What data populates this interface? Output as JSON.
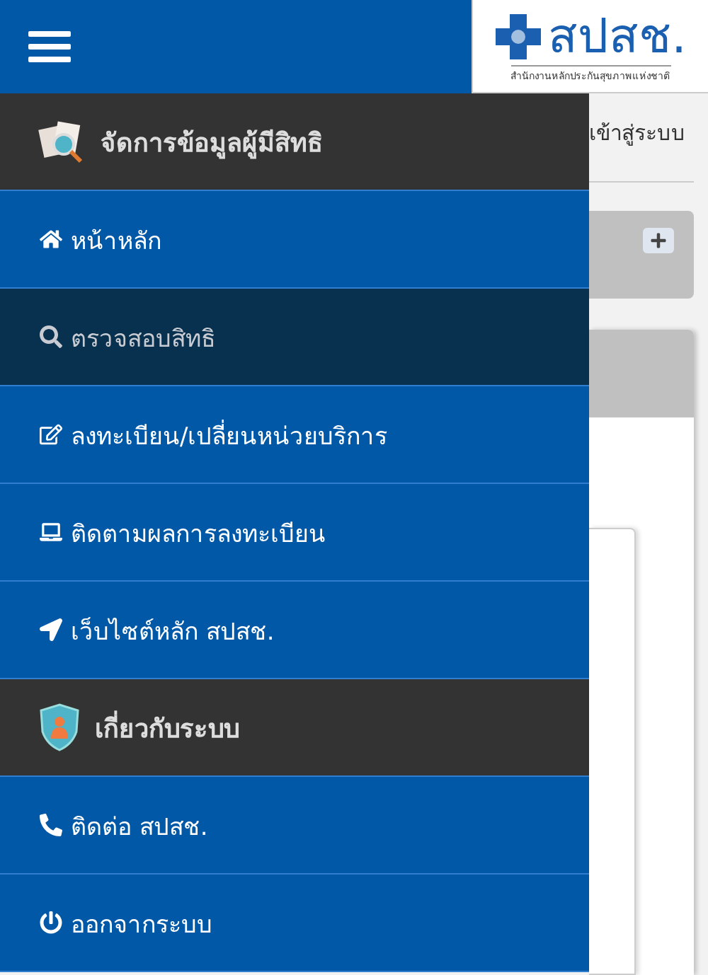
{
  "header": {
    "logo": {
      "title": "สปสช.",
      "subtitle": "สำนักงานหลักประกันสุขภาพแห่งชาติ"
    }
  },
  "background": {
    "login_text": "เข้าสู่ระบบ"
  },
  "menu": [
    {
      "kind": "section",
      "label": "จัดการข้อมูลผู้มีสิทธิ"
    },
    {
      "kind": "link",
      "label": "หน้าหลัก",
      "selected": false
    },
    {
      "kind": "link",
      "label": "ตรวจสอบสิทธิ",
      "selected": true
    },
    {
      "kind": "link",
      "label": "ลงทะเบียน/เปลี่ยนหน่วยบริการ",
      "selected": false
    },
    {
      "kind": "link",
      "label": "ติดตามผลการลงทะเบียน",
      "selected": false
    },
    {
      "kind": "link",
      "label": "เว็บไซต์หลัก สปสช.",
      "selected": false
    },
    {
      "kind": "section",
      "label": "เกี่ยวกับระบบ"
    },
    {
      "kind": "link",
      "label": "ติดต่อ สปสช.",
      "selected": false
    },
    {
      "kind": "link",
      "label": "ออกจากระบบ",
      "selected": false
    }
  ]
}
